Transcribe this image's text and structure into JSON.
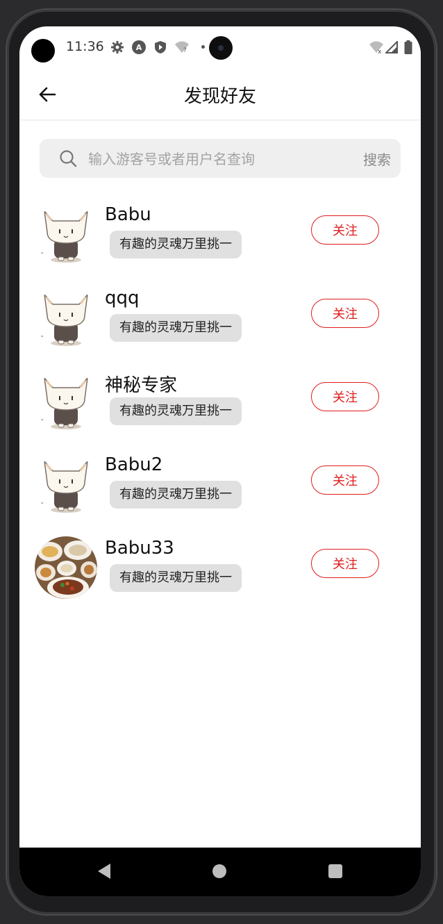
{
  "status_bar": {
    "time": "11:36",
    "icons": [
      "settings-icon",
      "a-icon",
      "shield-play-icon",
      "wifi-question-icon",
      "wifi-off-icon",
      "signal-icon",
      "battery-icon"
    ]
  },
  "header": {
    "title": "发现好友",
    "back_icon": "arrow-left-icon"
  },
  "search": {
    "placeholder": "输入游客号或者用户名查询",
    "value": "",
    "button_label": "搜索"
  },
  "friends": [
    {
      "name": "Babu",
      "signature": "有趣的灵魂万里挑一",
      "follow_label": "关注",
      "avatar": "cat-avatar"
    },
    {
      "name": "qqq",
      "signature": "有趣的灵魂万里挑一",
      "follow_label": "关注",
      "avatar": "cat-avatar"
    },
    {
      "name": "神秘专家",
      "signature": "有趣的灵魂万里挑一",
      "follow_label": "关注",
      "avatar": "cat-avatar"
    },
    {
      "name": "Babu2",
      "signature": "有趣的灵魂万里挑一",
      "follow_label": "关注",
      "avatar": "cat-avatar"
    },
    {
      "name": "Babu33",
      "signature": "有趣的灵魂万里挑一",
      "follow_label": "关注",
      "avatar": "food-photo-avatar"
    }
  ],
  "colors": {
    "accent": "#e01b1b",
    "search_bg": "#efefef",
    "signature_bg": "#e0e0e0"
  }
}
